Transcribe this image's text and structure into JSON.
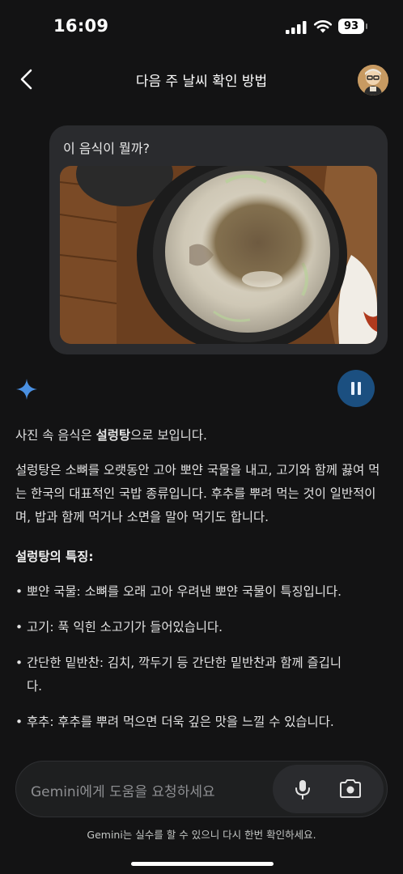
{
  "status_bar": {
    "time": "16:09",
    "battery": "93"
  },
  "header": {
    "title": "다음 주 날씨 확인 방법"
  },
  "user_message": {
    "text": "이 음식이 뭘까?"
  },
  "response": {
    "intro_prefix": "사진 속 음식은 ",
    "intro_bold": "설렁탕",
    "intro_suffix": "으로 보입니다.",
    "paragraph": "설렁탕은 소뼈를 오랫동안 고아 뽀얀 국물을 내고, 고기와 함께 끓여 먹는 한국의 대표적인 국밥 종류입니다. 후추를 뿌려 먹는 것이 일반적이며, 밥과 함께 먹거나 소면을 말아 먹기도 합니다.",
    "features_heading": "설렁탕의 특징:",
    "bullets": [
      "뽀얀 국물: 소뼈를 오래 고아 우려낸 뽀얀 국물이 특징입니다.",
      "고기: 푹 익힌 소고기가 들어있습니다.",
      "간단한 밑반찬: 김치, 깍두기 등 간단한 밑반찬과 함께 즐깁니다.",
      "후추: 후추를 뿌려 먹으면 더욱 깊은 맛을 느낄 수 있습니다."
    ]
  },
  "input": {
    "placeholder": "Gemini에게 도움을 요청하세요"
  },
  "disclaimer": "Gemini는 실수를 할 수 있으니 다시 한번 확인하세요.",
  "icons": {
    "back": "chevron-left-icon",
    "spark": "gemini-spark-icon",
    "pause": "pause-icon",
    "mic": "mic-icon",
    "camera": "camera-icon"
  },
  "colors": {
    "background": "#131314",
    "bubble": "#2a2b2e",
    "pause_button": "#1b4f80",
    "spark": "#4a90e2"
  }
}
